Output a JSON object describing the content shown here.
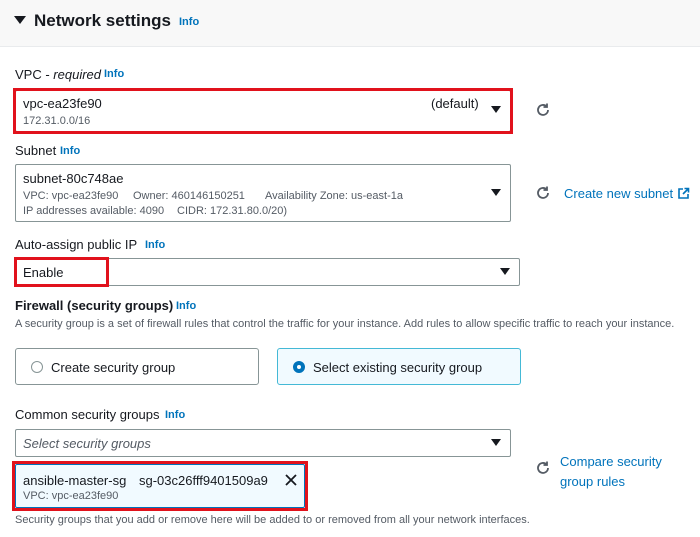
{
  "section": {
    "title": "Network settings",
    "info": "Info"
  },
  "vpc": {
    "label": "VPC - ",
    "required": "required",
    "info": "Info",
    "value": "vpc-ea23fe90",
    "tag": "(default)",
    "cidr": "172.31.0.0/16"
  },
  "subnet": {
    "label": "Subnet",
    "info": "Info",
    "value": "subnet-80c748ae",
    "vpc_line": "VPC: vpc-ea23fe90",
    "owner_line": "Owner: 460146150251",
    "az_line": "Availability Zone: us-east-1a",
    "ip_line": "IP addresses available: 4090",
    "cidr_line": "CIDR: 172.31.80.0/20)",
    "create_link": "Create new subnet"
  },
  "auto_ip": {
    "label": "Auto-assign public IP",
    "info": "Info",
    "value": "Enable"
  },
  "firewall": {
    "label": "Firewall (security groups)",
    "info": "Info",
    "description": "A security group is a set of firewall rules that control the traffic for your instance. Add rules to allow specific traffic to reach your instance.",
    "option_create": "Create security group",
    "option_existing": "Select existing security group"
  },
  "common_sg": {
    "label": "Common security groups",
    "info": "Info",
    "placeholder": "Select security groups",
    "selected_name": "ansible-master-sg",
    "selected_id": "sg-03c26fff9401509a9",
    "selected_vpc": "VPC: vpc-ea23fe90",
    "compare_line1": "Compare security",
    "compare_line2": "group rules",
    "footer_note": "Security groups that you add or remove here will be added to or removed from all your network interfaces."
  },
  "colors": {
    "accent": "#0073bb",
    "highlight": "#e1121c",
    "selected_bg": "#f1faff"
  }
}
